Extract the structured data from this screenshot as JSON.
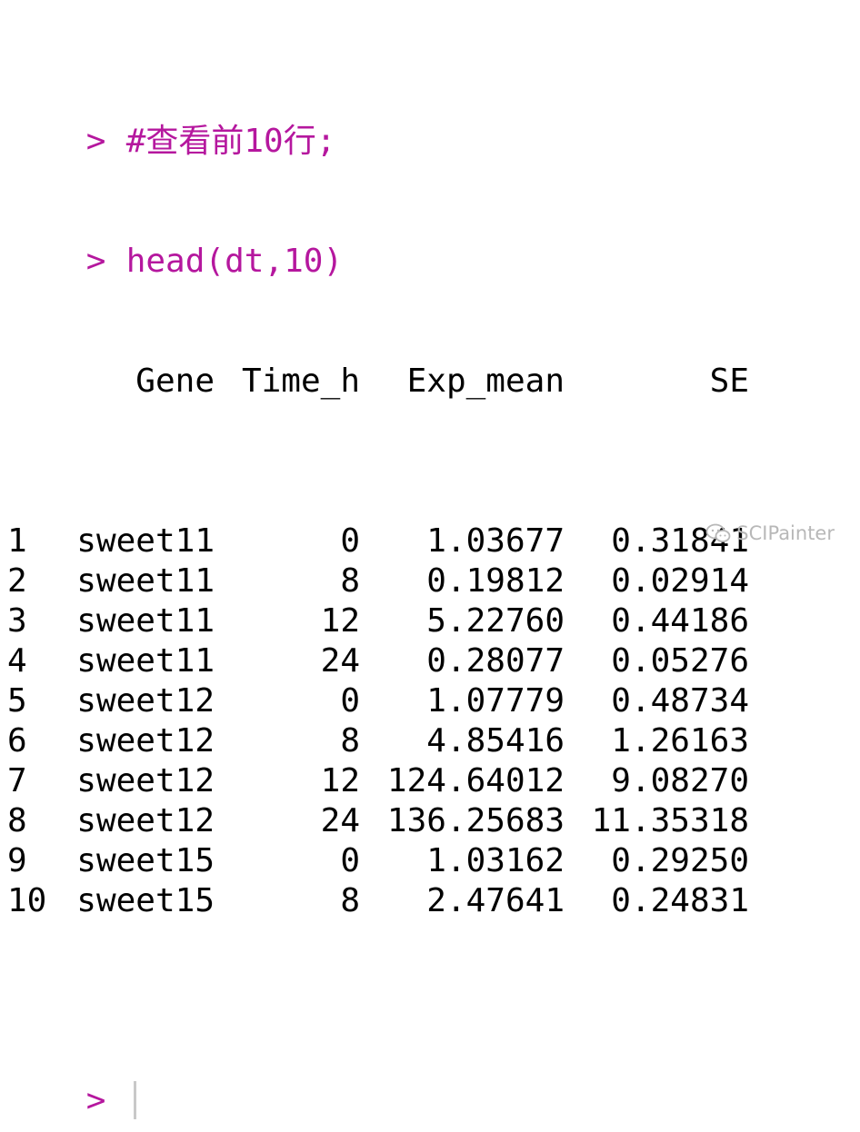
{
  "console": {
    "prompt_symbol": ">",
    "commands": [
      "#查看前10行;",
      "head(dt,10)"
    ],
    "table": {
      "headers": [
        "",
        "Gene",
        "Time_h",
        "Exp_mean",
        "SE"
      ],
      "rows": [
        [
          "1",
          "sweet11",
          "0",
          "1.03677",
          "0.31841"
        ],
        [
          "2",
          "sweet11",
          "8",
          "0.19812",
          "0.02914"
        ],
        [
          "3",
          "sweet11",
          "12",
          "5.22760",
          "0.44186"
        ],
        [
          "4",
          "sweet11",
          "24",
          "0.28077",
          "0.05276"
        ],
        [
          "5",
          "sweet12",
          "0",
          "1.07779",
          "0.48734"
        ],
        [
          "6",
          "sweet12",
          "8",
          "4.85416",
          "1.26163"
        ],
        [
          "7",
          "sweet12",
          "12",
          "124.64012",
          "9.08270"
        ],
        [
          "8",
          "sweet12",
          "24",
          "136.25683",
          "11.35318"
        ],
        [
          "9",
          "sweet15",
          "0",
          "1.03162",
          "0.29250"
        ],
        [
          "10",
          "sweet15",
          "8",
          "2.47641",
          "0.24831"
        ]
      ]
    }
  },
  "watermark": {
    "text": "SCIPainter",
    "icon": "wechat-icon"
  },
  "colors": {
    "prompt": "#b5179e",
    "output": "#000000",
    "watermark": "#b8b8b8"
  }
}
